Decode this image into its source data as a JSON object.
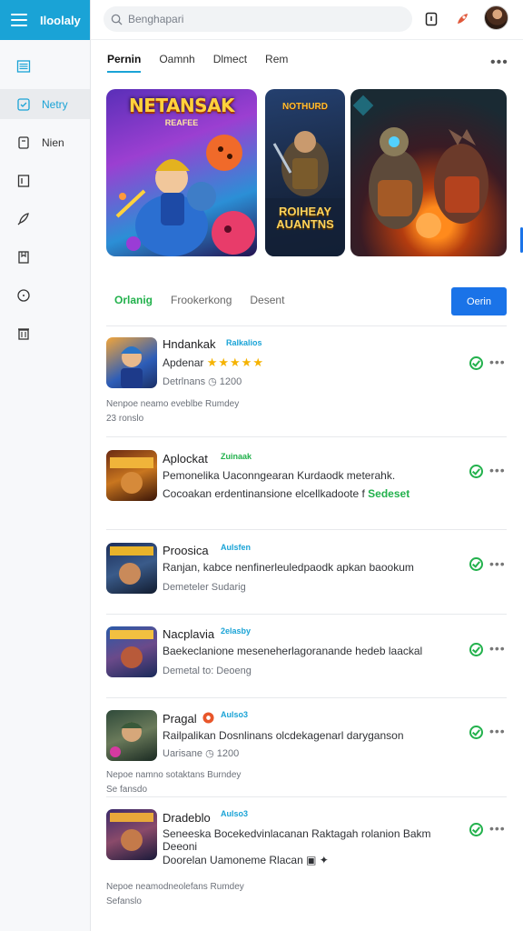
{
  "sidebar": {
    "brand_title": "Iloolaly",
    "items": [
      {
        "label": ""
      },
      {
        "label": "Netry"
      },
      {
        "label": "Nien"
      }
    ]
  },
  "topbar": {
    "search_placeholder": "Benghapari"
  },
  "tabs": [
    "Pernin",
    "Oamnh",
    "Dlmect",
    "Rem"
  ],
  "banners": {
    "b1_head": "NETANSAK",
    "b1_sub": "REAFEE",
    "b2_head": "NOTHURD",
    "b2_head2": "ROIHEAY AUANTNS"
  },
  "section": {
    "tabs": [
      "Orlanig",
      "Frookerkong",
      "Desent"
    ],
    "open_label": "Oerin"
  },
  "rows": [
    {
      "title": "Hndankak",
      "tag": "Ralkalios",
      "line1": "Apdenar",
      "line2": "Detrlnans ◷ 1200",
      "note": "Nenpoe neamo eveblbe Rumdey\n23 ronslo"
    },
    {
      "title": "Aplockat",
      "tag": "Zuinaak",
      "line1": "Pemonelika Uaconngearan Kurdaodk meterahk.",
      "line2": "Cocoakan erdentinansione elcellkadoote f",
      "line2b": "Sedeset"
    },
    {
      "title": "Proosica",
      "tag": "Aulsfen",
      "line1": "Ranjan, kabce nenfinerleuledpaodk apkan baookum",
      "line2": "Demeteler Sudarig"
    },
    {
      "title": "Nacplavia",
      "tag": "2elasby",
      "line1": "Baekeclanione meseneherlagoranande hedeb laackal",
      "line2": "Demetal to: Deoeng"
    },
    {
      "title": "Pragal",
      "tag": "Aulso3",
      "line1": "Railpalikan Dosnlinans olcdekagenarl daryganson",
      "line2": "Uarisane ◷ 1200",
      "note": "Nepoe namno sotaktans Burndey\nSe fansdo"
    },
    {
      "title": "Dradeblo",
      "tag": "Aulso3",
      "line1": "Seneeska Bocekedvinlacanan Raktagah rolanion Bakm",
      "line1b": "Deeoni",
      "line2": "Doorelan Uamoneme Rlacan ▣ ✦",
      "note": "Nepoe neamodneolefans Rumdey\nSefanslo"
    }
  ],
  "colors": {
    "accent": "#1aa3d6",
    "green": "#22b14c",
    "button": "#1a73e8"
  }
}
